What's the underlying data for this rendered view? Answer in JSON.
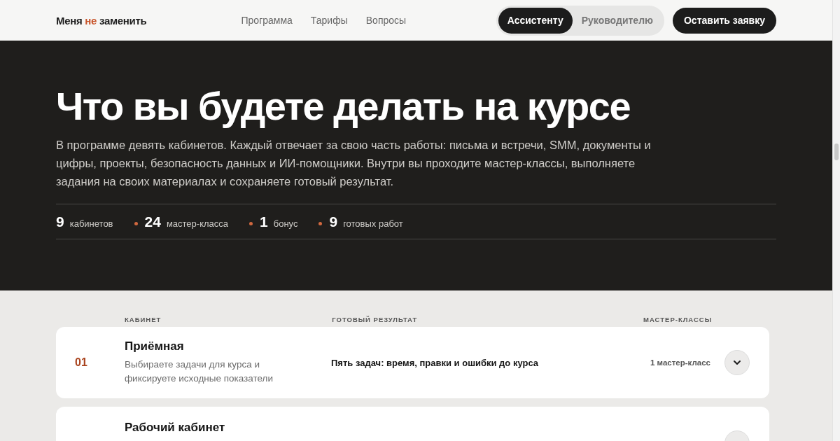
{
  "header": {
    "logo": "Меня **не** заменить",
    "nav": [
      "Программа",
      "Тарифы",
      "Вопросы"
    ],
    "audience_tabs": [
      {
        "label": "Ассистенту",
        "selected": true
      },
      {
        "label": "Руководителю",
        "selected": false
      }
    ],
    "cta": "Оставить заявку"
  },
  "hero": {
    "title": "Что вы будете делать на курсе",
    "text": "В программе девять кабинетов. Каждый отвечает за свою часть работы: письма и встречи, SMM, документы и цифры, проекты, безопасность данных и ИИ-помощники. Внутри вы проходите мастер-классы, выполняете задания на своих материалах и сохраняете готовый результат.",
    "stats": [
      {
        "value": "9",
        "label": "кабинетов"
      },
      {
        "value": "24",
        "label": "мастер-класса"
      },
      {
        "value": "1",
        "label": "бонус"
      },
      {
        "value": "9",
        "label": "готовых работ"
      }
    ]
  },
  "table": {
    "columns": [
      "КАБИНЕТ",
      "ГОТОВЫЙ РЕЗУЛЬТАТ",
      "МАСТЕР-КЛАССЫ"
    ],
    "rows": [
      {
        "number": "01",
        "title": "Приёмная",
        "description": "Выбираете задачи для курса и фиксируете исходные показатели",
        "result": "Пять задач: время, правки и ошибки до курса",
        "classes": "1 мастер-класс",
        "expanded": false
      },
      {
        "title": "Рабочий кабинет"
      }
    ]
  }
}
